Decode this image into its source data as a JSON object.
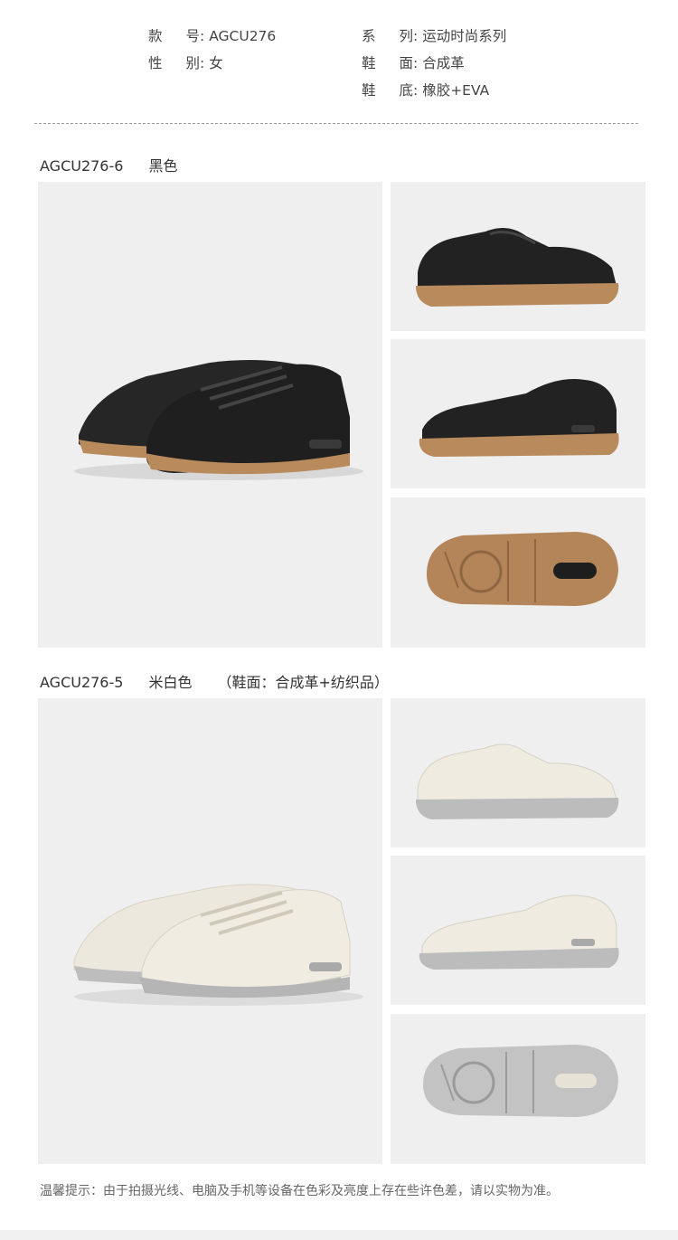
{
  "specs": {
    "style_no": {
      "label1": "款",
      "label2": "号:",
      "value": "AGCU276"
    },
    "series": {
      "label1": "系",
      "label2": "列:",
      "value": "运动时尚系列"
    },
    "gender": {
      "label1": "性",
      "label2": "别:",
      "value": "女"
    },
    "upper": {
      "label1": "鞋",
      "label2": "面:",
      "value": "合成革"
    },
    "sole": {
      "label1": "鞋",
      "label2": "底:",
      "value": "橡胶+EVA"
    }
  },
  "variants": [
    {
      "code": "AGCU276-6",
      "color": "黑色",
      "note": ""
    },
    {
      "code": "AGCU276-5",
      "color": "米白色",
      "note": "（鞋面：合成革+纺织品）"
    }
  ],
  "footer": {
    "notice": "温馨提示：由于拍摄光线、电脑及手机等设备在色彩及亮度上存在些许色差，请以实物为准。"
  },
  "colors": {
    "black_upper": "#2a2a2a",
    "gum_sole": "#b98a5c",
    "cream_upper": "#ece8dd",
    "grey_sole": "#b9b9b9",
    "panel_bg": "#efefef"
  }
}
